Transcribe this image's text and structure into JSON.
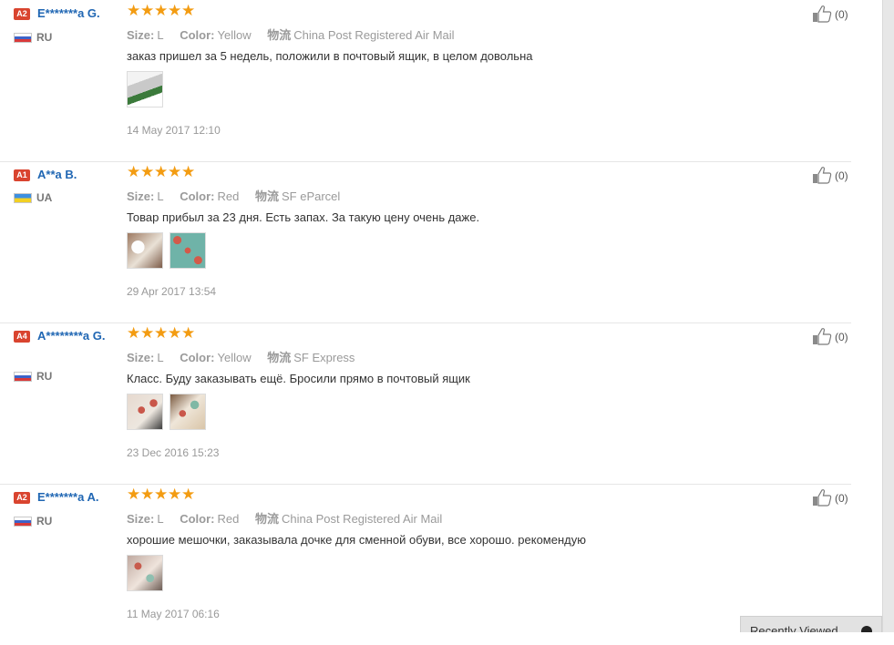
{
  "reviews": [
    {
      "level": "A2",
      "name": "E*******a G.",
      "country_code": "RU",
      "country_flag": "ru",
      "stars": 5,
      "size_label": "Size:",
      "size": "L",
      "color_label": "Color:",
      "color": "Yellow",
      "shipping_label": "物流",
      "shipping": "China Post Registered Air Mail",
      "text": "заказ пришел за 5 недель, положили в почтовый ящик, в целом довольна",
      "photo_count": 1,
      "date": "14 May 2017 12:10",
      "helpful": "(0)"
    },
    {
      "level": "A1",
      "name": "A**a B.",
      "country_code": "UA",
      "country_flag": "ua",
      "stars": 5,
      "size_label": "Size:",
      "size": "L",
      "color_label": "Color:",
      "color": "Red",
      "shipping_label": "物流",
      "shipping": "SF eParcel",
      "text": "Товар прибыл за 23 дня. Есть запах. За такую цену очень даже.",
      "photo_count": 2,
      "date": "29 Apr 2017 13:54",
      "helpful": "(0)"
    },
    {
      "level": "A4",
      "name": "A********a G.",
      "country_code": "RU",
      "country_flag": "ru",
      "stars": 5,
      "size_label": "Size:",
      "size": "L",
      "color_label": "Color:",
      "color": "Yellow",
      "shipping_label": "物流",
      "shipping": "SF Express",
      "text": "Класс. Буду заказывать ещё. Бросили прямо в почтовый ящик",
      "photo_count": 2,
      "date": "23 Dec 2016 15:23",
      "helpful": "(0)"
    },
    {
      "level": "A2",
      "name": "E*******a A.",
      "country_code": "RU",
      "country_flag": "ru",
      "stars": 5,
      "size_label": "Size:",
      "size": "L",
      "color_label": "Color:",
      "color": "Red",
      "shipping_label": "物流",
      "shipping": "China Post Registered Air Mail",
      "text": "хорошие мешочки, заказывала дочке для сменной обуви, все хорошо. рекомендую",
      "photo_count": 1,
      "date": "11 May 2017 06:16",
      "helpful": "(0)"
    }
  ],
  "recently_viewed_label": "Recently Viewed",
  "colors": {
    "star": "#f39c12",
    "level_badge": "#d9442f",
    "username": "#1f66b3"
  }
}
